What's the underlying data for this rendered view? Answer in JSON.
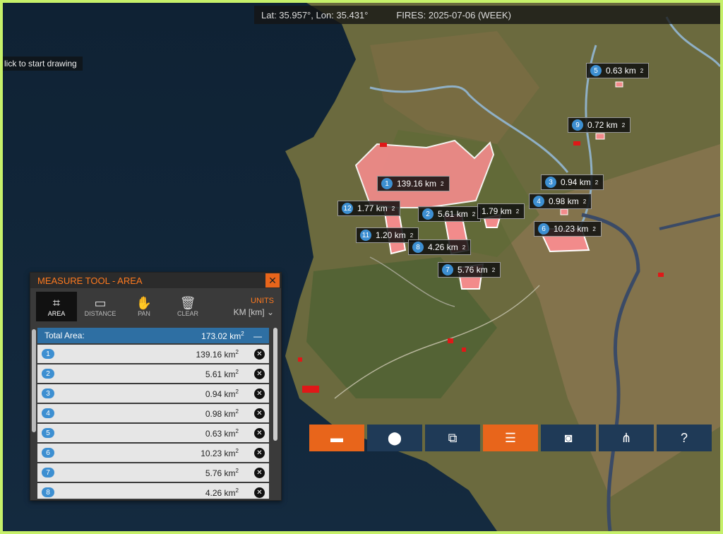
{
  "status": {
    "coords": "Lat: 35.957°, Lon: 35.431°",
    "fires": "FIRES: 2025-07-06 (WEEK)"
  },
  "hint": "lick to start drawing",
  "map_labels": [
    {
      "n": "1",
      "v": "139.16 km"
    },
    {
      "n": "12",
      "v": "1.77 km"
    },
    {
      "n": "2",
      "v": "5.61 km"
    },
    {
      "n": "",
      "v": "1.79 km"
    },
    {
      "n": "11",
      "v": "1.20 km"
    },
    {
      "n": "8",
      "v": "4.26 km"
    },
    {
      "n": "7",
      "v": "5.76 km"
    },
    {
      "n": "3",
      "v": "0.94 km"
    },
    {
      "n": "4",
      "v": "0.98 km"
    },
    {
      "n": "6",
      "v": "10.23 km"
    },
    {
      "n": "5",
      "v": "0.63 km"
    },
    {
      "n": "9",
      "v": "0.72 km"
    }
  ],
  "panel": {
    "title": "MEASURE TOOL - AREA",
    "close": "✕",
    "tools": [
      {
        "label": "AREA",
        "icon": "area-icon"
      },
      {
        "label": "DISTANCE",
        "icon": "ruler-icon"
      },
      {
        "label": "PAN",
        "icon": "hand-icon"
      },
      {
        "label": "CLEAR",
        "icon": "trash-icon"
      }
    ],
    "units_label": "UNITS",
    "units_value": "KM [km]",
    "total_label": "Total Area:",
    "total_value": "173.02 km",
    "rows": [
      {
        "n": "1",
        "v": "139.16 km"
      },
      {
        "n": "2",
        "v": "5.61 km"
      },
      {
        "n": "3",
        "v": "0.94 km"
      },
      {
        "n": "4",
        "v": "0.98 km"
      },
      {
        "n": "5",
        "v": "0.63 km"
      },
      {
        "n": "6",
        "v": "10.23 km"
      },
      {
        "n": "7",
        "v": "5.76 km"
      },
      {
        "n": "8",
        "v": "4.26 km"
      }
    ]
  },
  "toolbar": [
    {
      "name": "measure-button",
      "icon": "ruler-icon",
      "glyph": "📏",
      "active": true
    },
    {
      "name": "marker-button",
      "icon": "location-pin-icon",
      "glyph": "📍",
      "active": false
    },
    {
      "name": "layers-button",
      "icon": "copy-icon",
      "glyph": "⧉",
      "active": false
    },
    {
      "name": "settings-button",
      "icon": "sliders-icon",
      "glyph": "☷",
      "active": true
    },
    {
      "name": "screenshot-button",
      "icon": "camera-icon",
      "glyph": "📷",
      "active": false
    },
    {
      "name": "share-button",
      "icon": "share-icon",
      "glyph": "⋰",
      "active": false
    },
    {
      "name": "help-button",
      "icon": "help-icon",
      "glyph": "?",
      "active": false
    }
  ],
  "colors": {
    "accent": "#e8651b",
    "fire_area": "#f28b8b",
    "toolbar": "#1f3a57",
    "badge": "#3d8fd1"
  }
}
